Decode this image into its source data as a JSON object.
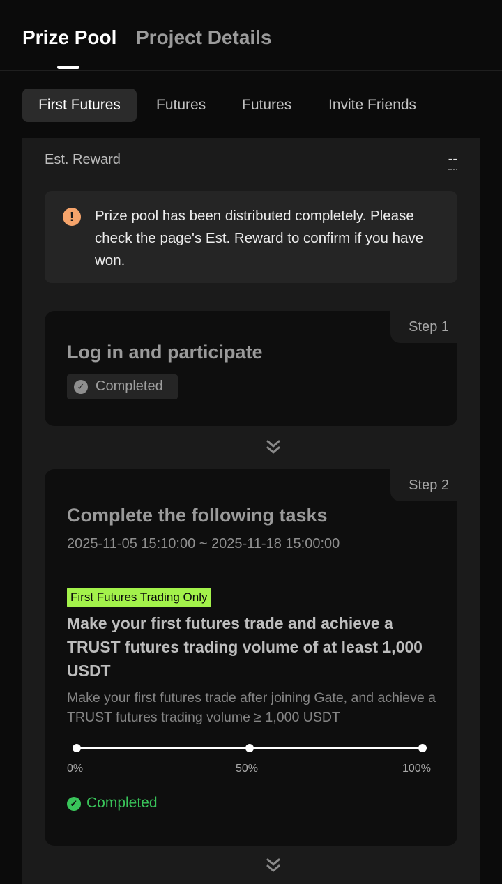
{
  "top_tabs": {
    "prize_pool": "Prize Pool",
    "project_details": "Project Details"
  },
  "sub_tabs": [
    "First Futures",
    "Futures",
    "Futures",
    "Invite Friends"
  ],
  "est_reward": {
    "label": "Est. Reward",
    "value": "--"
  },
  "notice": {
    "icon": "exclamation-icon",
    "text": "Prize pool has been distributed completely. Please check the page's Est. Reward to confirm if you have won."
  },
  "step1": {
    "label": "Step 1",
    "title": "Log in and participate",
    "status": "Completed"
  },
  "step2": {
    "label": "Step 2",
    "title": "Complete the following tasks",
    "date_range": "2025-11-05 15:10:00 ~ 2025-11-18 15:00:00",
    "tag": "First Futures Trading Only",
    "task_title": "Make your first futures trade and achieve a TRUST futures trading volume of at least 1,000 USDT",
    "task_desc": "Make your first futures trade after joining Gate, and achieve a TRUST futures trading volume ≥ 1,000 USDT",
    "progress_labels": [
      "0%",
      "50%",
      "100%"
    ],
    "progress_value": 1.0,
    "status": "Completed"
  },
  "colors": {
    "accent_green": "#39c45a",
    "tag_green": "#a3f24b",
    "warning_orange": "#f6a46b"
  }
}
